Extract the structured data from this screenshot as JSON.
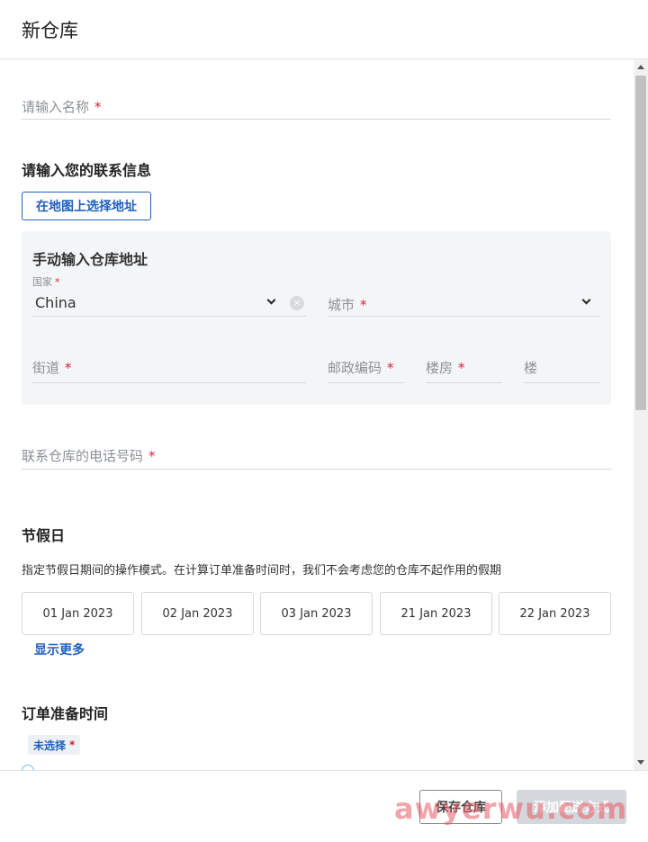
{
  "header": {
    "title": "新仓库"
  },
  "form": {
    "name": {
      "placeholder": "请输入名称",
      "required": "*"
    },
    "contact_title": "请输入您的联系信息",
    "map_button": "在地图上选择地址",
    "manual": {
      "title": "手动输入仓库地址",
      "country_label": "国家",
      "country_value": "China",
      "city_placeholder": "城市",
      "street_placeholder": "街道",
      "postal_placeholder": "邮政编码",
      "building_placeholder": "楼房",
      "floor_placeholder": "楼",
      "required": "*"
    },
    "phone": {
      "placeholder": "联系仓库的电话号码",
      "required": "*"
    },
    "holidays": {
      "title": "节假日",
      "description": "指定节假日期间的操作模式。在计算订单准备时间时，我们不会考虑您的仓库不起作用的假期",
      "dates": [
        "01 Jan 2023",
        "02 Jan 2023",
        "03 Jan 2023",
        "21 Jan 2023",
        "22 Jan 2023"
      ],
      "show_more": "显示更多"
    },
    "prep_time": {
      "title": "订单准备时间",
      "badge": "未选择",
      "required": "*"
    }
  },
  "footer": {
    "save_label": "保存仓库",
    "add_label": "添加配送方式"
  },
  "watermark": "awyerwu.com",
  "colors": {
    "accent": "#1f5fbf",
    "required": "#d6203f",
    "panel": "#f4f5f7"
  }
}
